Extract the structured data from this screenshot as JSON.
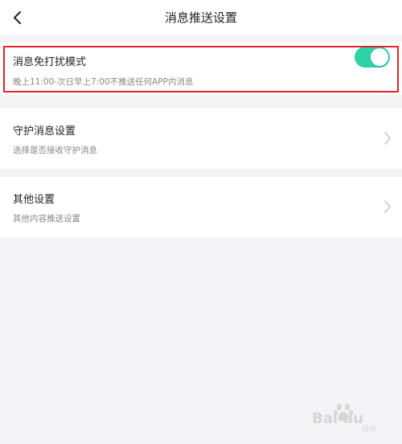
{
  "header": {
    "title": "消息推送设置",
    "back_icon": "chevron-left-icon"
  },
  "settings": {
    "dnd": {
      "title": "消息免打扰模式",
      "subtitle": "晚上11:00-次日早上7:00不推送任何APP内消息",
      "enabled": true,
      "toggle_color": "#2ed3a7"
    },
    "guard": {
      "title": "守护消息设置",
      "subtitle": "选择是否接收守护消息"
    },
    "other": {
      "title": "其他设置",
      "subtitle": "其他内容推送设置"
    }
  },
  "colors": {
    "background": "#f4f4f6",
    "highlight": "#e5232b"
  },
  "watermark": {
    "text": "Bai du",
    "sub": "经验"
  }
}
